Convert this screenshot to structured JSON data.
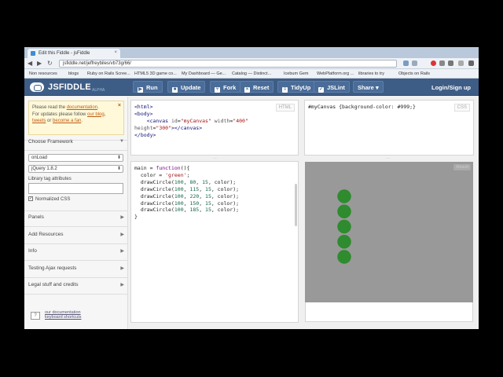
{
  "browser": {
    "tab_title": "Edit this Fiddle - jsFiddle",
    "url": "jsfiddle.net/jeffreybiles/vb73g/66/",
    "bookmarks": [
      "Non resources",
      "blogs",
      "Ruby on Rails Scree...",
      "HTML5 3D game co...",
      "My Dashboard — Ge...",
      "Catalog — Distinct...",
      "Icebum Gem",
      "WebPlatform.org ...",
      "libraries to try",
      "Objects on Rails"
    ]
  },
  "header": {
    "logo": "JSFIDDLE",
    "logo_sub": "ALPHA",
    "buttons": {
      "run": "Run",
      "update": "Update",
      "fork": "Fork",
      "reset": "Reset",
      "tidyup": "TidyUp",
      "jslint": "JSLint",
      "share": "Share"
    },
    "signin": "Login/Sign up"
  },
  "sidebar": {
    "notice": {
      "prefix": "Please read the",
      "documentation": "documentation",
      "line2": "For updates please follow",
      "blog": "our blog",
      "tweets": "tweets",
      "or": "or",
      "fan": "become a fan"
    },
    "choose_framework": "Choose Framework",
    "load_option": "onLoad",
    "framework_option": "jQuery 1.8.2",
    "library_label": "Library tag attributes",
    "normalized_css": "Normalized CSS",
    "normalized_checked": true,
    "sections": [
      "Panels",
      "Add Resources",
      "Info",
      "Testing Ajax requests",
      "Legal stuff and credits"
    ],
    "help_text": "our documentation",
    "help_sub": "keyboard shortcuts"
  },
  "panels": {
    "html_label": "HTML",
    "css_label": "CSS",
    "result_label": "Result",
    "css_code": "#myCanvas {background-color: #999;}",
    "canvas_bg": "#999999",
    "circle_color": "#2e8b2e"
  },
  "chart_data": {
    "type": "scatter",
    "title": "",
    "xlabel": "",
    "ylabel": "",
    "series": [
      {
        "x": [
          100,
          100,
          100,
          100,
          100
        ],
        "y": [
          80,
          115,
          220,
          150,
          185
        ],
        "r": 15
      }
    ]
  }
}
